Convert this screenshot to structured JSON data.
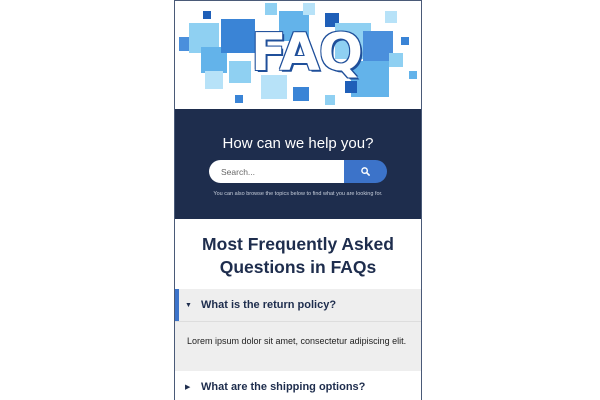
{
  "banner": {
    "logo_text": "FAQ",
    "accent": "#3c73c9",
    "light_blue": "#8fd0f2"
  },
  "hero": {
    "title": "How can we help you?",
    "search_placeholder": "Search...",
    "search_icon": "search-icon",
    "note": "You can also browse the topics below to find what you are looking for.",
    "background": "#1e2d4d"
  },
  "heading": {
    "line1": "Most Frequently Asked",
    "line2": "Questions in FAQs"
  },
  "faqs": [
    {
      "question": "What is the return policy?",
      "state": "expanded",
      "answer": "Lorem ipsum dolor sit amet, consectetur adipiscing elit.",
      "arrow": "▼"
    },
    {
      "question": "What are the shipping options?",
      "state": "collapsed",
      "arrow": "▶"
    }
  ]
}
